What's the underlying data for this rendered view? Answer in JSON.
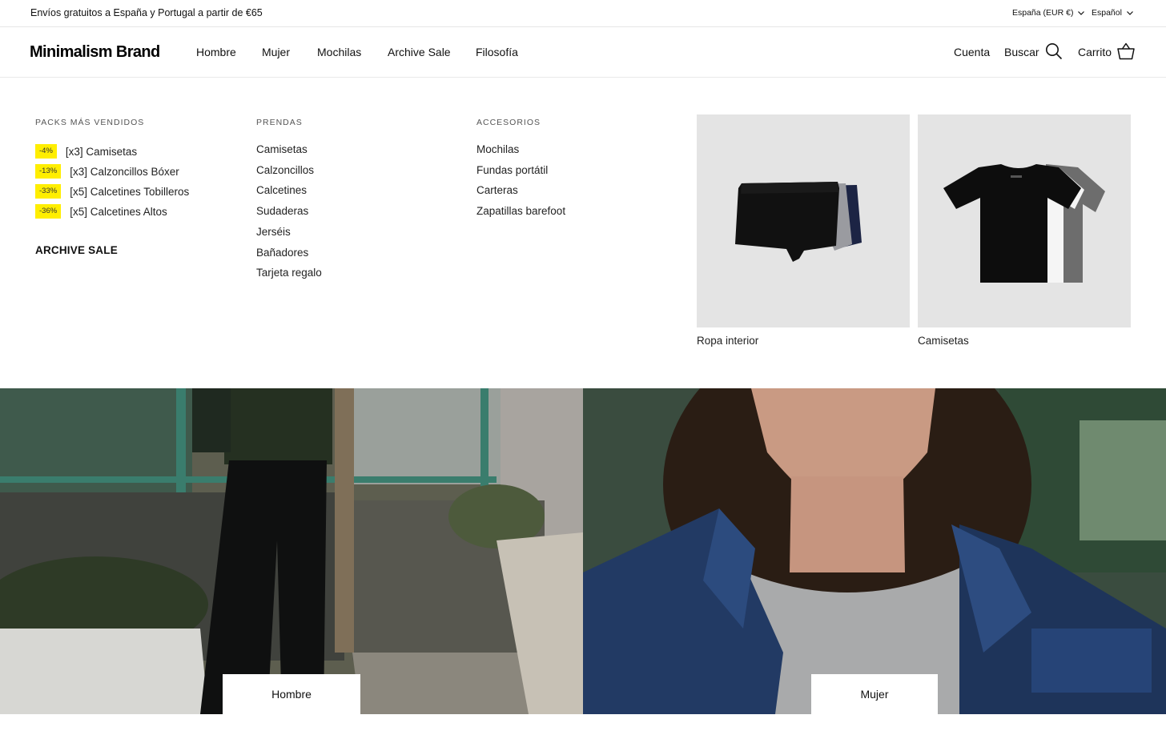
{
  "announcement": {
    "message": "Envíos gratuitos a España y Portugal a partir de €65",
    "country_selector": "España (EUR €)",
    "language_selector": "Español"
  },
  "header": {
    "logo": "Minimalism Brand",
    "nav": [
      "Hombre",
      "Mujer",
      "Mochilas",
      "Archive Sale",
      "Filosofía"
    ],
    "account": "Cuenta",
    "search": "Buscar",
    "cart": "Carrito"
  },
  "menu": {
    "packs": {
      "title": "PACKS MÁS VENDIDOS",
      "items": [
        {
          "badge": "-4%",
          "label": "[x3] Camisetas"
        },
        {
          "badge": "-13%",
          "label": "[x3] Calzoncillos Bóxer"
        },
        {
          "badge": "-33%",
          "label": "[x5] Calcetines Tobilleros"
        },
        {
          "badge": "-36%",
          "label": "[x5] Calcetines Altos"
        }
      ],
      "archive_sale": "ARCHIVE SALE"
    },
    "prendas": {
      "title": "PRENDAS",
      "items": [
        "Camisetas",
        "Calzoncillos",
        "Calcetines",
        "Sudaderas",
        "Jerséis",
        "Bañadores",
        "Tarjeta regalo"
      ]
    },
    "accesorios": {
      "title": "ACCESORIOS",
      "items": [
        "Mochilas",
        "Fundas portátil",
        "Carteras",
        "Zapatillas barefoot"
      ]
    },
    "cards": [
      {
        "label": "Ropa interior"
      },
      {
        "label": "Camisetas"
      }
    ]
  },
  "hero": {
    "left_button": "Hombre",
    "right_button": "Mujer"
  },
  "colors": {
    "badge": "#ffee00",
    "card_bg": "#e4e4e4"
  }
}
